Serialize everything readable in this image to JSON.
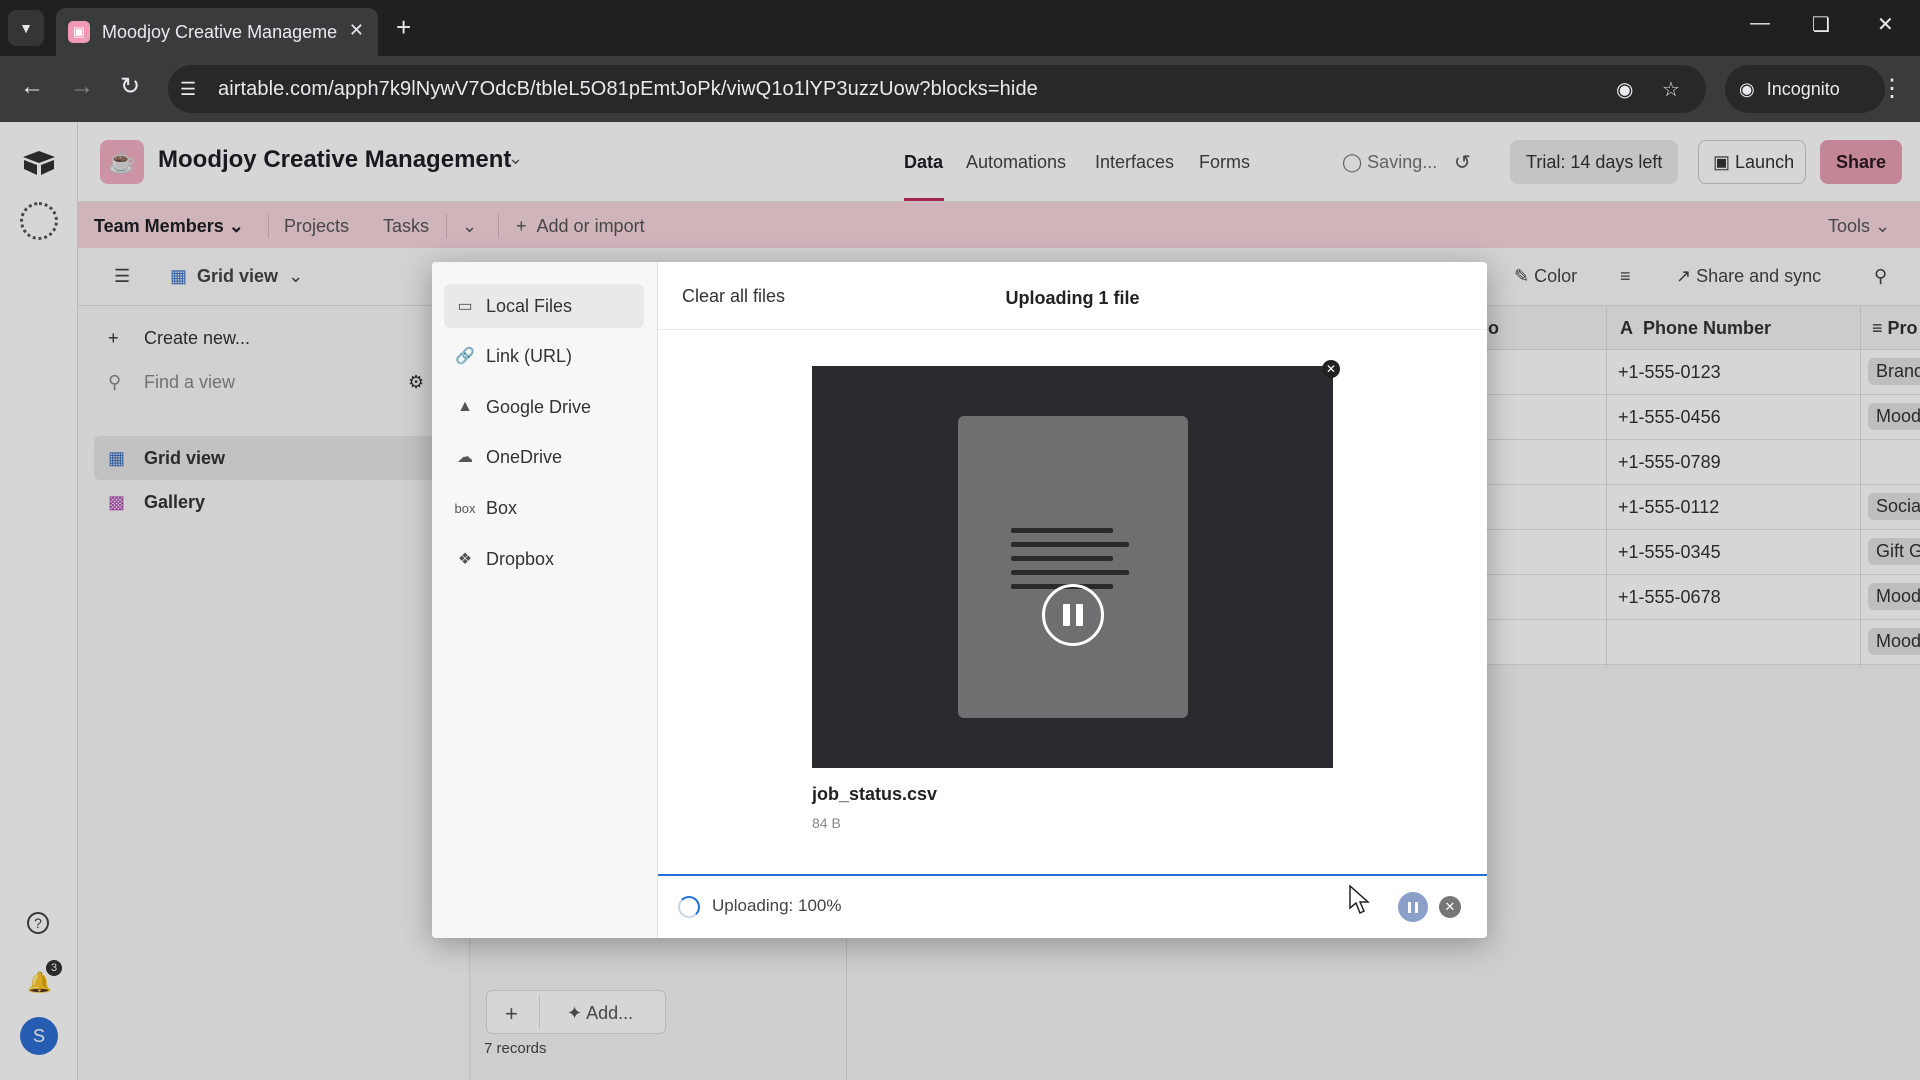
{
  "browser": {
    "tab_title": "Moodjoy Creative Management",
    "url": "airtable.com/apph7k9lNywV7OdcB/tbleL5O81pEmtJoPk/viwQ1o1lYP3uzzUow?blocks=hide",
    "incognito_label": "Incognito"
  },
  "app": {
    "base_name": "Moodjoy Creative Management",
    "nav_tabs": [
      "Data",
      "Automations",
      "Interfaces",
      "Forms"
    ],
    "saving_label": "Saving...",
    "trial_label": "Trial: 14 days left",
    "launch_label": "Launch",
    "share_label": "Share",
    "accent_color": "#c42d5b",
    "notification_count": "3",
    "avatar_initial": "S"
  },
  "tables": {
    "items": [
      "Team Members",
      "Projects",
      "Tasks"
    ],
    "add_label": "Add or import",
    "tools_label": "Tools"
  },
  "viewbar": {
    "view_name": "Grid view",
    "color_label": "Color",
    "share_sync_label": "Share and sync"
  },
  "sidebar": {
    "create_label": "Create new...",
    "find_placeholder": "Find a view",
    "views": [
      "Grid view",
      "Gallery"
    ]
  },
  "grid": {
    "col_partial": "o",
    "col_phone": "Phone Number",
    "col_project": "Pro",
    "rows": [
      {
        "phone": "+1-555-0123",
        "project": "Brand"
      },
      {
        "phone": "+1-555-0456",
        "project": "Mood"
      },
      {
        "phone": "+1-555-0789",
        "project": ""
      },
      {
        "phone": "+1-555-0112",
        "project": "Social"
      },
      {
        "phone": "+1-555-0345",
        "project": "Gift G"
      },
      {
        "phone": "+1-555-0678",
        "project": "Mood"
      },
      {
        "phone": "",
        "project": "Mood"
      }
    ],
    "add_label": "Add...",
    "records_label": "7 records"
  },
  "upload_modal": {
    "sources": [
      "Local Files",
      "Link (URL)",
      "Google Drive",
      "OneDrive",
      "Box",
      "Dropbox"
    ],
    "clear_all_label": "Clear all files",
    "title": "Uploading 1 file",
    "file_name": "job_status.csv",
    "file_size": "84 B",
    "status_text": "Uploading: 100%",
    "progress_percent": 100,
    "progress_color": "#1e6fd9"
  }
}
